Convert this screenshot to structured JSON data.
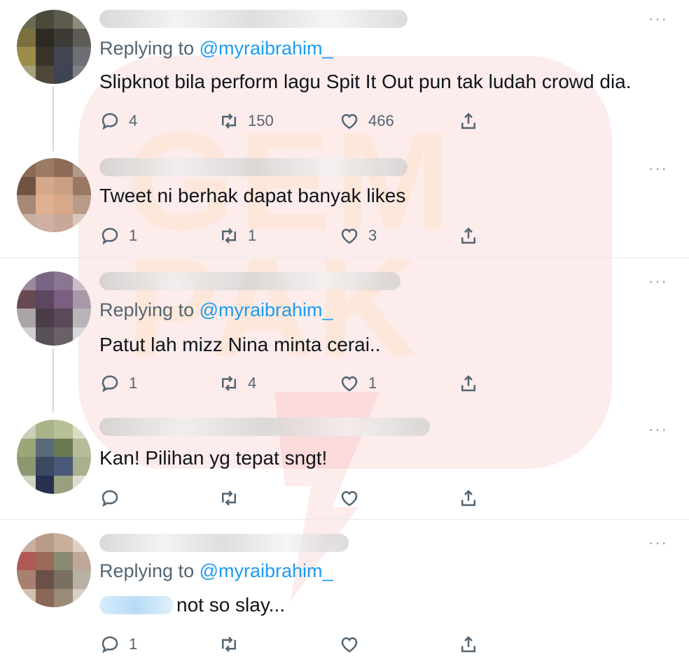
{
  "watermark": {
    "text": "GEM PAK"
  },
  "icons": {
    "reply": "reply-icon",
    "retweet": "retweet-icon",
    "like": "heart-icon",
    "share": "share-icon",
    "more": "more-icon"
  },
  "more_label": "···",
  "tweets": [
    {
      "replying_prefix": "Replying to ",
      "replying_handle": "@myraibrahim_",
      "text": "Slipknot bila perform lagu Spit It Out pun tak ludah crowd dia.",
      "replies": "4",
      "retweets": "150",
      "likes": "466"
    },
    {
      "text": "Tweet ni berhak dapat banyak likes",
      "replies": "1",
      "retweets": "1",
      "likes": "3"
    },
    {
      "replying_prefix": "Replying to ",
      "replying_handle": "@myraibrahim_",
      "text": "Patut lah mizz Nina minta cerai..",
      "replies": "1",
      "retweets": "4",
      "likes": "1"
    },
    {
      "text": "Kan! Pilihan yg tepat sngt!",
      "replies": "",
      "retweets": "",
      "likes": ""
    },
    {
      "replying_prefix": "Replying to ",
      "replying_handle": "@myraibrahim_",
      "text": "not so slay...",
      "replies": "1",
      "retweets": "",
      "likes": ""
    }
  ]
}
